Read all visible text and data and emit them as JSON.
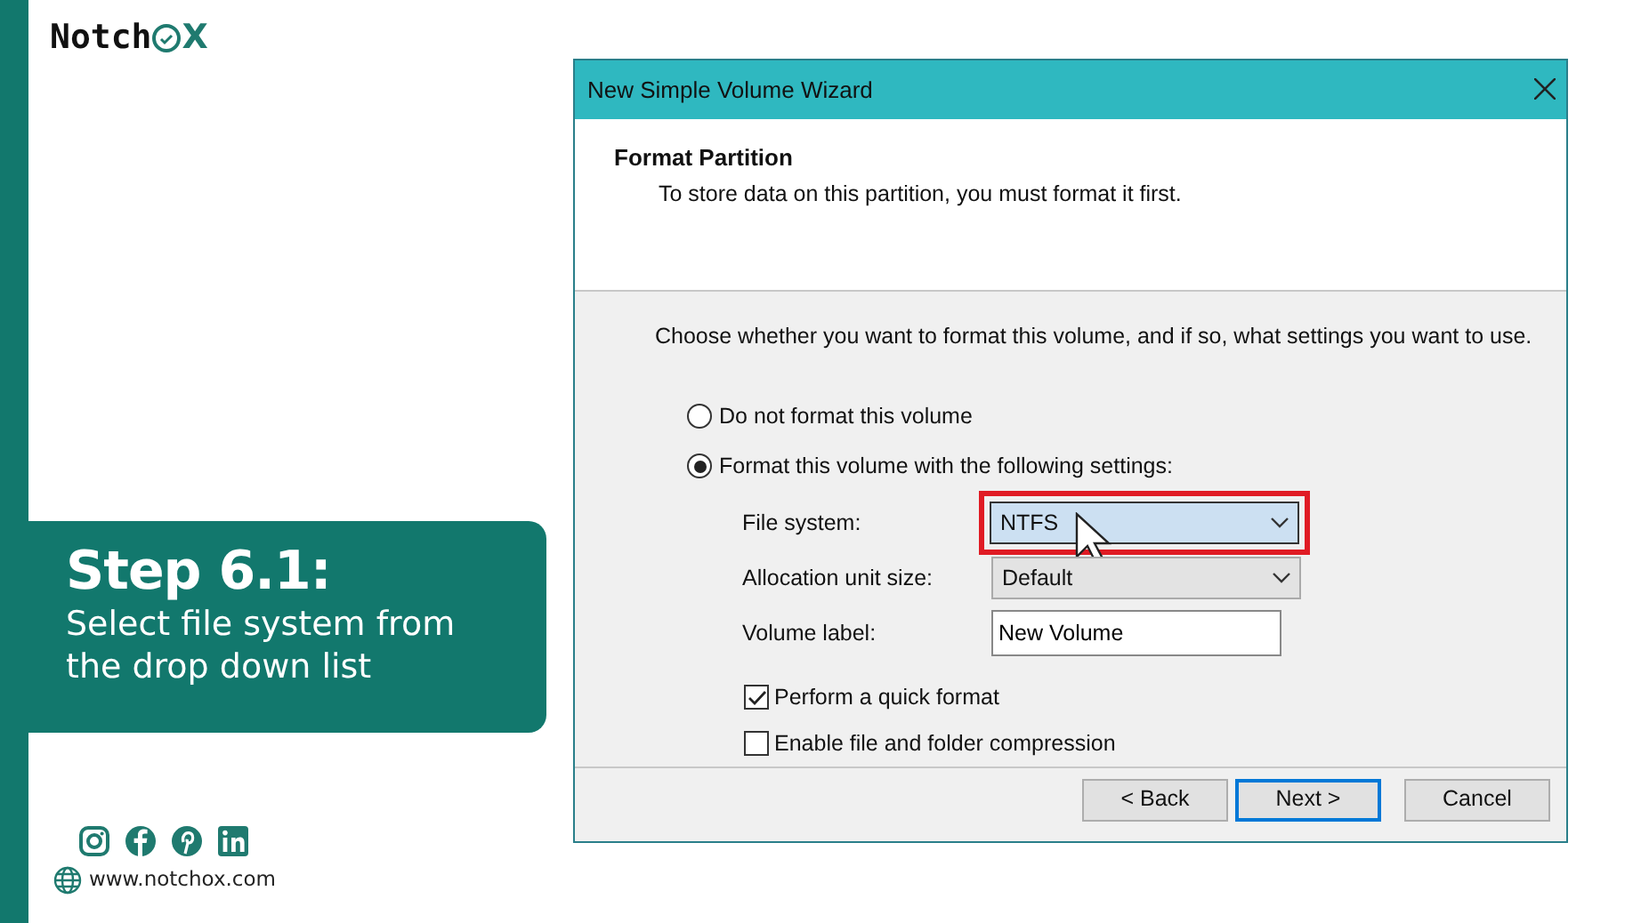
{
  "brand": {
    "name": "Notch",
    "suffix": "X"
  },
  "step": {
    "title": "Step 6.1:",
    "description": "Select file system from the drop down list"
  },
  "website": "www.notchox.com",
  "dialog": {
    "title": "New Simple Volume Wizard",
    "header": {
      "title": "Format Partition",
      "subtitle": "To store data on this partition, you must format it first."
    },
    "prompt": "Choose whether you want to format this volume, and if so, what settings you want to use.",
    "options": [
      {
        "label": "Do not format this volume",
        "selected": false
      },
      {
        "label": "Format this volume with the following settings:",
        "selected": true
      }
    ],
    "fields": [
      {
        "kind": "select",
        "label": "File system:",
        "value": "NTFS",
        "focused": true,
        "highlighted": true
      },
      {
        "kind": "select",
        "label": "Allocation unit size:",
        "value": "Default",
        "focused": false,
        "highlighted": false
      },
      {
        "kind": "text",
        "label": "Volume label:",
        "value": "New Volume"
      }
    ],
    "checkboxes": [
      {
        "label": "Perform a quick format",
        "checked": true
      },
      {
        "label": "Enable file and folder compression",
        "checked": false
      }
    ],
    "buttons": [
      {
        "label": "< Back",
        "default": false
      },
      {
        "label": "Next >",
        "default": true
      },
      {
        "label": "Cancel",
        "default": false
      }
    ]
  }
}
